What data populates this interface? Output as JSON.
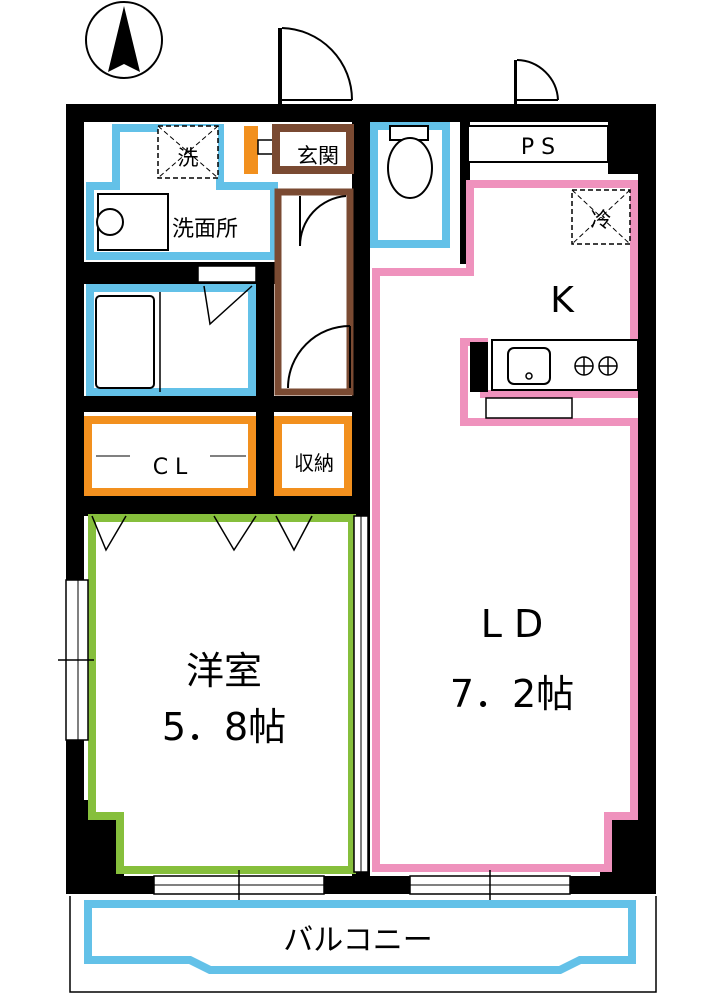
{
  "rooms": {
    "wash_label": "洗",
    "washroom_label": "洗面所",
    "entrance_label": "玄関",
    "ps_label": "P S",
    "fridge_label": "冷",
    "kitchen_label": "K",
    "closet_label": "C L",
    "storage_label": "収納",
    "western_room_label": "洋室",
    "western_room_size": "5．8帖",
    "ld_label": "L D",
    "ld_size": "7．2帖",
    "balcony_label": "バルコニー"
  },
  "colors": {
    "wall": "#000000",
    "wet_area": "#63c1e8",
    "entrance_hall": "#7a4a32",
    "storage": "#f2901e",
    "western_room": "#86bf3c",
    "ldk": "#ef92bd"
  },
  "icons": {
    "compass": "north-arrow-icon",
    "washer": "washing-machine-icon",
    "basin": "wash-basin-icon",
    "toilet": "toilet-icon",
    "fridge": "refrigerator-icon",
    "sink": "kitchen-sink-icon",
    "stove": "gas-stove-icon"
  }
}
